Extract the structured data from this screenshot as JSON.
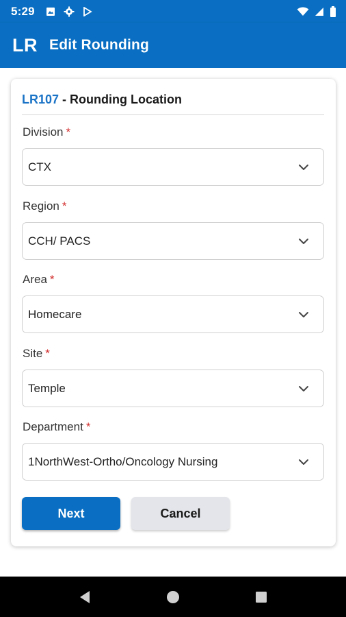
{
  "status_bar": {
    "time": "5:29",
    "left_icons": [
      "photo-icon",
      "gear-icon",
      "play-store-icon"
    ],
    "right_icons": [
      "wifi-icon",
      "signal-icon",
      "battery-icon"
    ]
  },
  "app_bar": {
    "logo": "LR",
    "title": "Edit Rounding"
  },
  "card": {
    "code": "LR107",
    "title": " - Rounding Location"
  },
  "fields": [
    {
      "label": "Division",
      "required_mark": "*",
      "value": "CTX"
    },
    {
      "label": "Region",
      "required_mark": "*",
      "value": "CCH/ PACS"
    },
    {
      "label": "Area",
      "required_mark": "*",
      "value": "Homecare"
    },
    {
      "label": "Site",
      "required_mark": "*",
      "value": "Temple"
    },
    {
      "label": "Department",
      "required_mark": "*",
      "value": "1NorthWest-Ortho/Oncology Nursing"
    }
  ],
  "buttons": {
    "next": "Next",
    "cancel": "Cancel"
  },
  "colors": {
    "primary": "#0a6fc2",
    "code_accent": "#1a73c6",
    "required": "#d32f2f",
    "cancel_bg": "#e3e5ea"
  },
  "nav_bar": {
    "icons": [
      "back-icon",
      "home-icon",
      "recents-icon"
    ]
  }
}
